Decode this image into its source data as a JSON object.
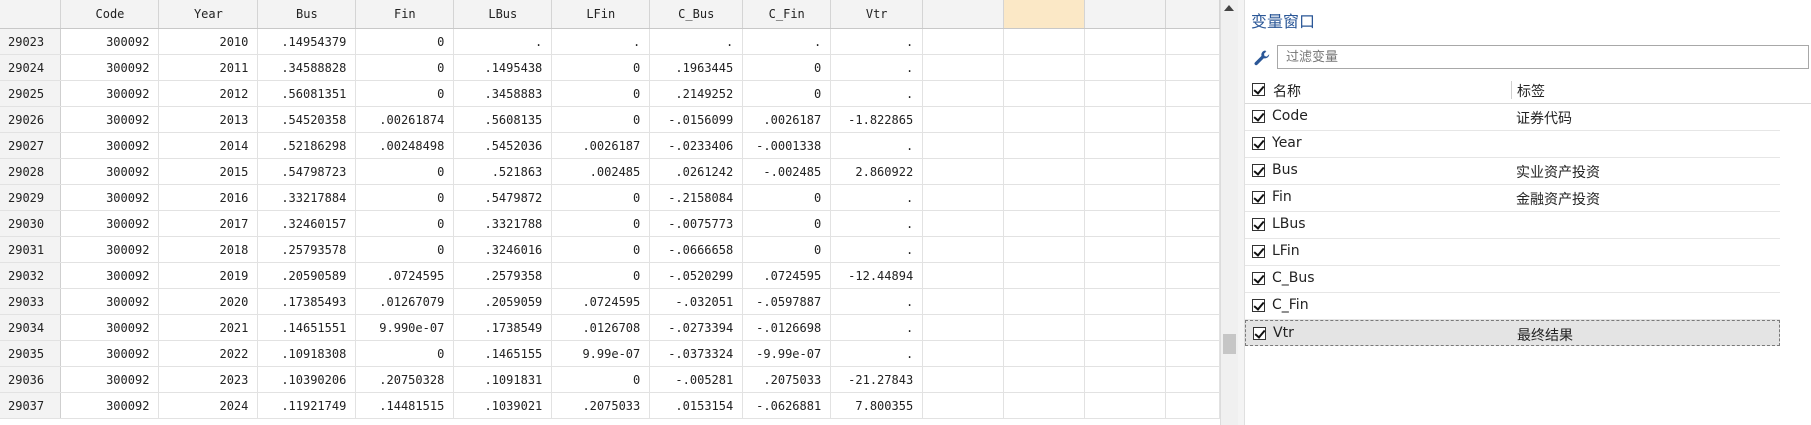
{
  "data_grid": {
    "columns": [
      "Code",
      "Year",
      "Bus",
      "Fin",
      "LBus",
      "LFin",
      "C_Bus",
      "C_Fin",
      "Vtr"
    ],
    "extra_columns": 4,
    "rows": [
      [
        "29023",
        "300092",
        "2010",
        ".14954379",
        "0",
        ".",
        ".",
        ".",
        ".",
        "."
      ],
      [
        "29024",
        "300092",
        "2011",
        ".34588828",
        "0",
        ".1495438",
        "0",
        ".1963445",
        "0",
        "."
      ],
      [
        "29025",
        "300092",
        "2012",
        ".56081351",
        "0",
        ".3458883",
        "0",
        ".2149252",
        "0",
        "."
      ],
      [
        "29026",
        "300092",
        "2013",
        ".54520358",
        ".00261874",
        ".5608135",
        "0",
        "-.0156099",
        ".0026187",
        "-1.822865"
      ],
      [
        "29027",
        "300092",
        "2014",
        ".52186298",
        ".00248498",
        ".5452036",
        ".0026187",
        "-.0233406",
        "-.0001338",
        "."
      ],
      [
        "29028",
        "300092",
        "2015",
        ".54798723",
        "0",
        ".521863",
        ".002485",
        ".0261242",
        "-.002485",
        "2.860922"
      ],
      [
        "29029",
        "300092",
        "2016",
        ".33217884",
        "0",
        ".5479872",
        "0",
        "-.2158084",
        "0",
        "."
      ],
      [
        "29030",
        "300092",
        "2017",
        ".32460157",
        "0",
        ".3321788",
        "0",
        "-.0075773",
        "0",
        "."
      ],
      [
        "29031",
        "300092",
        "2018",
        ".25793578",
        "0",
        ".3246016",
        "0",
        "-.0666658",
        "0",
        "."
      ],
      [
        "29032",
        "300092",
        "2019",
        ".20590589",
        ".0724595",
        ".2579358",
        "0",
        "-.0520299",
        ".0724595",
        "-12.44894"
      ],
      [
        "29033",
        "300092",
        "2020",
        ".17385493",
        ".01267079",
        ".2059059",
        ".0724595",
        "-.032051",
        "-.0597887",
        "."
      ],
      [
        "29034",
        "300092",
        "2021",
        ".14651551",
        "9.990e-07",
        ".1738549",
        ".0126708",
        "-.0273394",
        "-.0126698",
        "."
      ],
      [
        "29035",
        "300092",
        "2022",
        ".10918308",
        "0",
        ".1465155",
        "9.99e-07",
        "-.0373324",
        "-9.99e-07",
        "."
      ],
      [
        "29036",
        "300092",
        "2023",
        ".10390206",
        ".20750328",
        ".1091831",
        "0",
        "-.005281",
        ".2075033",
        "-21.27843"
      ],
      [
        "29037",
        "300092",
        "2024",
        ".11921749",
        ".14481515",
        ".1039021",
        ".2075033",
        ".0153154",
        "-.0626881",
        "7.800355"
      ]
    ]
  },
  "variables_panel": {
    "title": "变量窗口",
    "filter_placeholder": "过滤变量",
    "header_name": "名称",
    "header_label": "标签",
    "variables": [
      {
        "name": "Code",
        "label": "证券代码"
      },
      {
        "name": "Year",
        "label": ""
      },
      {
        "name": "Bus",
        "label": "实业资产投资"
      },
      {
        "name": "Fin",
        "label": "金融资产投资"
      },
      {
        "name": "LBus",
        "label": ""
      },
      {
        "name": "LFin",
        "label": ""
      },
      {
        "name": "C_Bus",
        "label": ""
      },
      {
        "name": "C_Fin",
        "label": ""
      },
      {
        "name": "Vtr",
        "label": "最终结果"
      }
    ],
    "selected_variable": "Vtr"
  },
  "colors": {
    "panel_title": "#2b5797",
    "header_bg": "#f3f3f3",
    "highlight_header": "#fbe8c6",
    "selected_row_bg": "#e4e4e4"
  }
}
